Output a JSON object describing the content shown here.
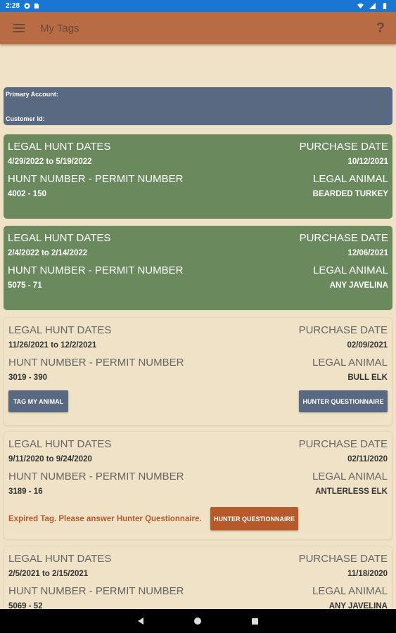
{
  "status": {
    "time": "2:28"
  },
  "app_bar": {
    "title": "My Tags",
    "help": "?"
  },
  "account": {
    "primary_label": "Primary Account:",
    "customer_label": "Customer Id:"
  },
  "labels": {
    "legal_hunt_dates": "LEGAL HUNT DATES",
    "purchase_date": "PURCHASE DATE",
    "hunt_permit": "HUNT NUMBER - PERMIT NUMBER",
    "legal_animal": "LEGAL ANIMAL"
  },
  "tags": [
    {
      "dates": "4/29/2022 to 5/19/2022",
      "purchase": "10/12/2021",
      "hunt": "4002 - 150",
      "animal": "BEARDED TURKEY"
    },
    {
      "dates": "2/4/2022 to 2/14/2022",
      "purchase": "12/06/2021",
      "hunt": "5075 - 71",
      "animal": "ANY JAVELINA"
    },
    {
      "dates": "11/26/2021 to 12/2/2021",
      "purchase": "02/09/2021",
      "hunt": "3019 - 390",
      "animal": "BULL ELK",
      "tag_button": "TAG MY ANIMAL",
      "questionnaire_button": "HUNTER QUESTIONNAIRE"
    },
    {
      "dates": "9/11/2020 to 9/24/2020",
      "purchase": "02/11/2020",
      "hunt": "3189 - 16",
      "animal": "ANTLERLESS ELK",
      "expired_message": "Expired Tag. Please answer Hunter Questionnaire.",
      "questionnaire_button": "HUNTER QUESTIONNAIRE"
    },
    {
      "dates": "2/5/2021 to 2/15/2021",
      "purchase": "11/18/2020",
      "hunt": "5069 - 52",
      "animal": "ANY JAVELINA"
    }
  ],
  "colors": {
    "app_bar": "#b86c44",
    "active_card": "#6a8a5e",
    "account_card": "#596982",
    "background": "#efe2c6",
    "expired_button": "#b65a2c"
  }
}
